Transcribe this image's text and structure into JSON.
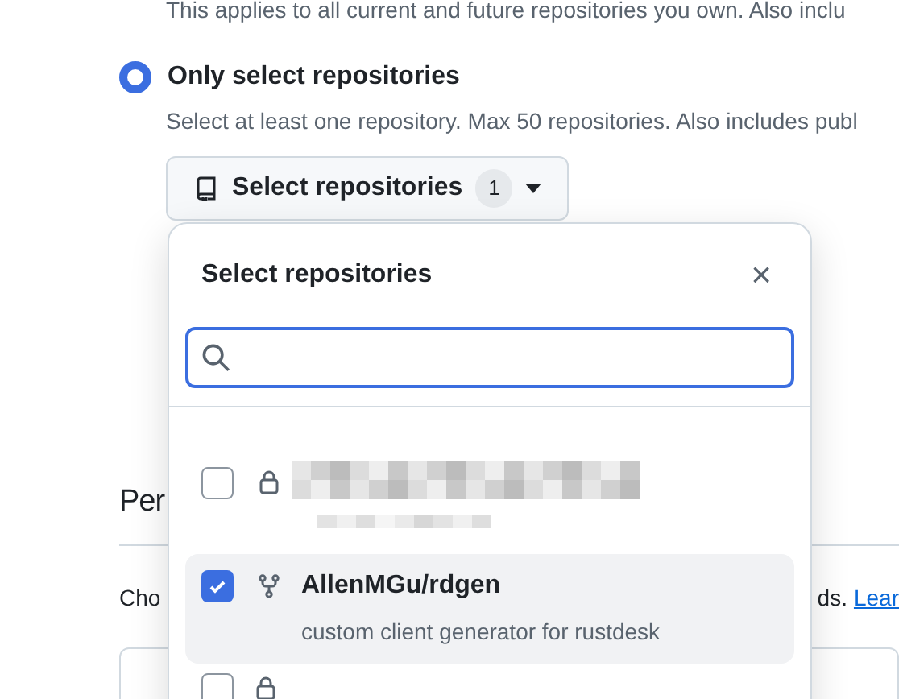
{
  "intro_text": "This applies to all current and future repositories you own. Also inclu",
  "option": {
    "label": "Only select repositories",
    "selected": true,
    "description": "Select at least one repository. Max 50 repositories. Also includes publ"
  },
  "select_button": {
    "label": "Select repositories",
    "count": "1"
  },
  "section": {
    "heading": "Per",
    "text": "Cho",
    "text_end": "ds.",
    "link": "Lear"
  },
  "popover": {
    "title": "Select repositories",
    "close": "×",
    "items": [
      {
        "kind": "blurred",
        "checked": false,
        "selected": false
      },
      {
        "kind": "repo",
        "name": "AllenMGu/rdgen",
        "description": "custom client generator for rustdesk",
        "checked": true,
        "selected": true
      },
      {
        "kind": "cut",
        "checked": false,
        "selected": false
      }
    ]
  }
}
